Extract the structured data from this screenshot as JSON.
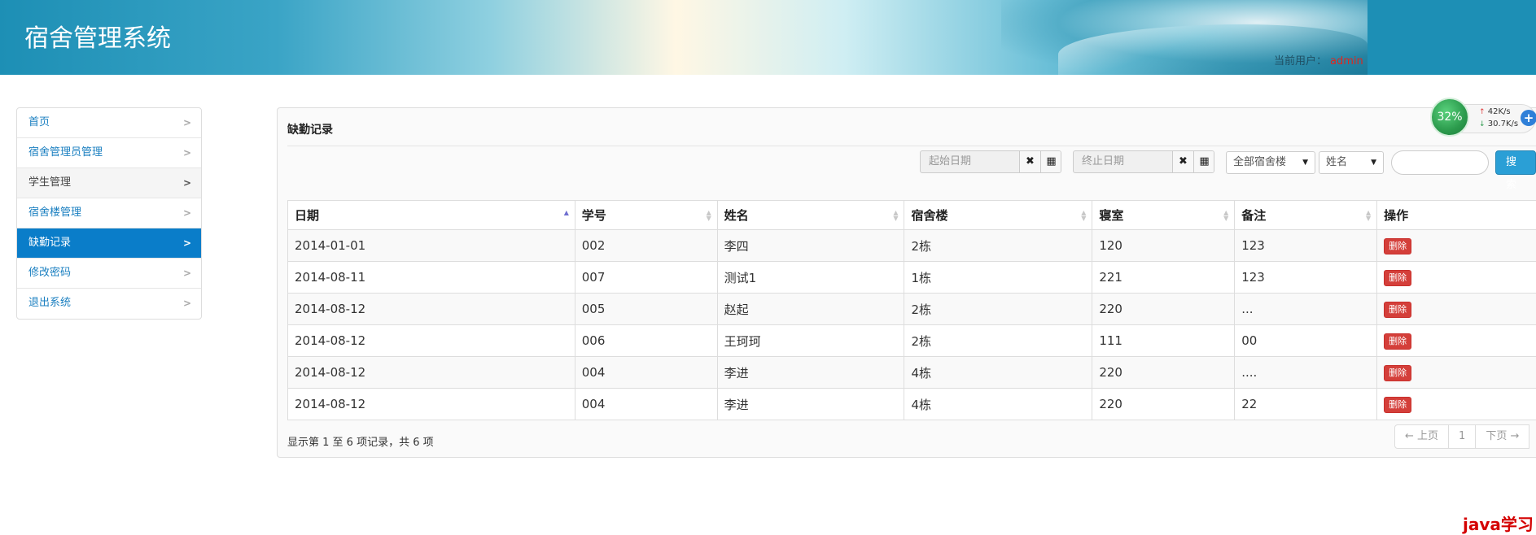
{
  "header": {
    "app_title": "宿舍管理系统",
    "current_user_label": "当前用户：",
    "current_user_name": "admin"
  },
  "sidebar": {
    "items": [
      {
        "label": "首页"
      },
      {
        "label": "宿舍管理员管理"
      },
      {
        "label": "学生管理"
      },
      {
        "label": "宿舍楼管理"
      },
      {
        "label": "缺勤记录"
      },
      {
        "label": "修改密码"
      },
      {
        "label": "退出系统"
      }
    ]
  },
  "panel": {
    "title": "缺勤记录"
  },
  "filters": {
    "start_date_placeholder": "起始日期",
    "end_date_placeholder": "终止日期",
    "building_selected": "全部宿舍楼",
    "field_selected": "姓名",
    "search_value": "",
    "search_button": "搜索"
  },
  "table": {
    "columns": [
      "日期",
      "学号",
      "姓名",
      "宿舍楼",
      "寝室",
      "备注",
      "操作"
    ],
    "rows": [
      {
        "date": "2014-01-01",
        "student_no": "002",
        "name": "李四",
        "building": "2栋",
        "room": "120",
        "remark": "123",
        "action": "删除"
      },
      {
        "date": "2014-08-11",
        "student_no": "007",
        "name": "测试1",
        "building": "1栋",
        "room": "221",
        "remark": "123",
        "action": "删除"
      },
      {
        "date": "2014-08-12",
        "student_no": "005",
        "name": "赵起",
        "building": "2栋",
        "room": "220",
        "remark": "...",
        "action": "删除"
      },
      {
        "date": "2014-08-12",
        "student_no": "006",
        "name": "王珂珂",
        "building": "2栋",
        "room": "111",
        "remark": "00",
        "action": "删除"
      },
      {
        "date": "2014-08-12",
        "student_no": "004",
        "name": "李进",
        "building": "4栋",
        "room": "220",
        "remark": "....",
        "action": "删除"
      },
      {
        "date": "2014-08-12",
        "student_no": "004",
        "name": "李进",
        "building": "4栋",
        "room": "220",
        "remark": "22",
        "action": "删除"
      }
    ]
  },
  "footer": {
    "info": "显示第 1 至 6 项记录，共 6 项",
    "prev": "← 上页",
    "page": "1",
    "next": "下页 →"
  },
  "net_widget": {
    "percent": "32%",
    "up_speed": "42K/s",
    "down_speed": "30.7K/s"
  },
  "watermark": "java学习"
}
